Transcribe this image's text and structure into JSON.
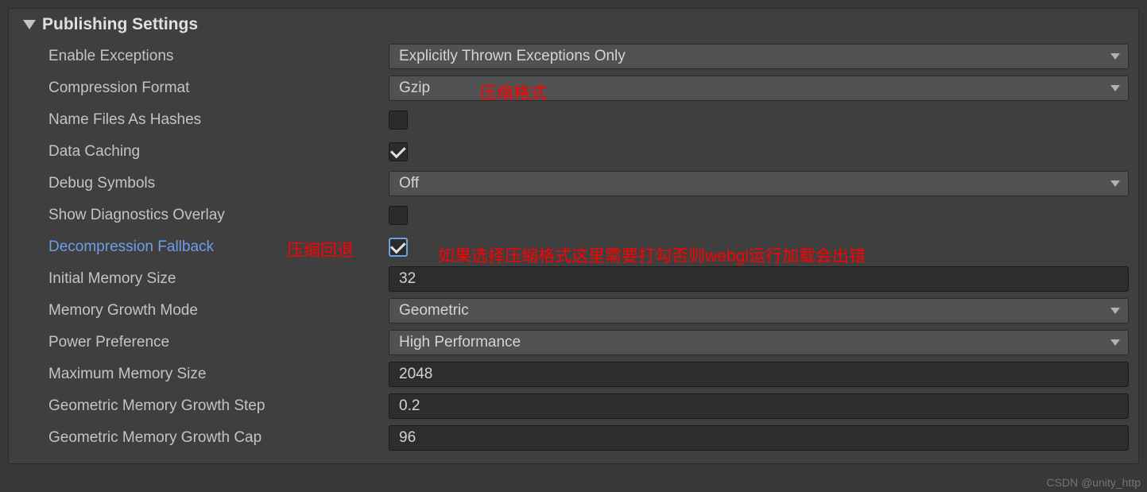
{
  "section": {
    "title": "Publishing Settings"
  },
  "fields": {
    "enableExceptions": {
      "label": "Enable Exceptions",
      "value": "Explicitly Thrown Exceptions Only"
    },
    "compressionFormat": {
      "label": "Compression Format",
      "value": "Gzip"
    },
    "nameFilesAsHashes": {
      "label": "Name Files As Hashes"
    },
    "dataCaching": {
      "label": "Data Caching"
    },
    "debugSymbols": {
      "label": "Debug Symbols",
      "value": "Off"
    },
    "showDiagnosticsOverlay": {
      "label": "Show Diagnostics Overlay"
    },
    "decompressionFallback": {
      "label": "Decompression Fallback"
    },
    "initialMemorySize": {
      "label": "Initial Memory Size",
      "value": "32"
    },
    "memoryGrowthMode": {
      "label": "Memory Growth Mode",
      "value": "Geometric"
    },
    "powerPreference": {
      "label": "Power Preference",
      "value": "High Performance"
    },
    "maximumMemorySize": {
      "label": "Maximum Memory Size",
      "value": "2048"
    },
    "geometricMemoryGrowthStep": {
      "label": "Geometric Memory Growth Step",
      "value": "0.2"
    },
    "geometricMemoryGrowthCap": {
      "label": "Geometric Memory Growth Cap",
      "value": "96"
    }
  },
  "annotations": {
    "compressionFormat": "压缩格式",
    "decompressionLabel": "压缩回退",
    "decompressionNote": "如果选择压缩格式这里需要打勾否则webgl运行加载会出错"
  },
  "watermark": "CSDN @unity_http"
}
